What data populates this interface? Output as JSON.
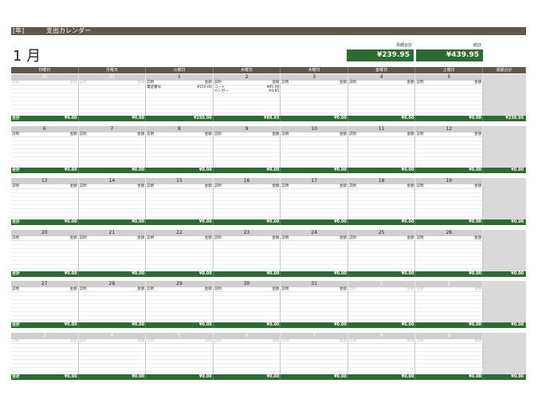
{
  "header": {
    "year_label": "[年]",
    "title": "支出カレンダー",
    "month": "1 月"
  },
  "totals": {
    "monthly_label": "月額合計",
    "monthly_value": "¥239.95",
    "grand_label": "総計",
    "grand_value": "¥439.95"
  },
  "day_headers": [
    "日曜日",
    "月曜日",
    "火曜日",
    "水曜日",
    "木曜日",
    "金曜日",
    "土曜日",
    "週額合計"
  ],
  "labels": {
    "desc": "説明",
    "amount": "金額",
    "sum": "合計"
  },
  "colors": {
    "header_bar": "#5f574e",
    "accent_green": "#2e6b33",
    "side_gray": "#d9d9d9"
  },
  "weeks": [
    {
      "days": [
        "30",
        "31",
        "1",
        "2",
        "3",
        "4",
        "5"
      ],
      "dim": [
        true,
        true,
        false,
        false,
        false,
        false,
        false
      ],
      "totals": [
        "¥0.00",
        "¥0.00",
        "¥150.00",
        "¥89.95",
        "¥0.00",
        "¥0.00",
        "¥0.00"
      ],
      "week_total": "¥239.95",
      "entries": {
        "2": [
          {
            "d": "電話番号",
            "a": "¥150.00"
          }
        ],
        "3": [
          {
            "d": "コート",
            "a": "¥85.00"
          },
          {
            "d": "ハンガー",
            "a": "¥4.95"
          }
        ]
      }
    },
    {
      "days": [
        "6",
        "7",
        "8",
        "9",
        "10",
        "11",
        "12"
      ],
      "dim": [
        false,
        false,
        false,
        false,
        false,
        false,
        false
      ],
      "totals": [
        "¥0.00",
        "¥0.00",
        "¥0.00",
        "¥0.00",
        "¥0.00",
        "¥0.00",
        "¥0.00"
      ],
      "week_total": "¥0.00",
      "entries": {}
    },
    {
      "days": [
        "13",
        "14",
        "15",
        "16",
        "17",
        "18",
        "19"
      ],
      "dim": [
        false,
        false,
        false,
        false,
        false,
        false,
        false
      ],
      "totals": [
        "¥0.00",
        "¥0.00",
        "¥0.00",
        "¥0.00",
        "¥0.00",
        "¥0.00",
        "¥0.00"
      ],
      "week_total": "¥0.00",
      "entries": {}
    },
    {
      "days": [
        "20",
        "21",
        "22",
        "23",
        "24",
        "25",
        "26"
      ],
      "dim": [
        false,
        false,
        false,
        false,
        false,
        false,
        false
      ],
      "totals": [
        "¥0.00",
        "¥0.00",
        "¥0.00",
        "¥0.00",
        "¥0.00",
        "¥0.00",
        "¥0.00"
      ],
      "week_total": "¥0.00",
      "entries": {}
    },
    {
      "days": [
        "27",
        "28",
        "29",
        "30",
        "31",
        "1",
        "2"
      ],
      "dim": [
        false,
        false,
        false,
        false,
        false,
        true,
        true
      ],
      "totals": [
        "¥0.00",
        "¥0.00",
        "¥0.00",
        "¥0.00",
        "¥0.00",
        "¥0.00",
        "¥0.00"
      ],
      "week_total": "¥0.00",
      "entries": {}
    },
    {
      "days": [
        "3",
        "4",
        "5",
        "6",
        "7",
        "8",
        "9"
      ],
      "dim": [
        true,
        true,
        true,
        true,
        true,
        true,
        true
      ],
      "totals": [
        "¥0.00",
        "¥0.00",
        "¥0.00",
        "¥0.00",
        "¥0.00",
        "¥0.00",
        "¥0.00"
      ],
      "week_total": "¥0.00",
      "entries": {}
    }
  ]
}
